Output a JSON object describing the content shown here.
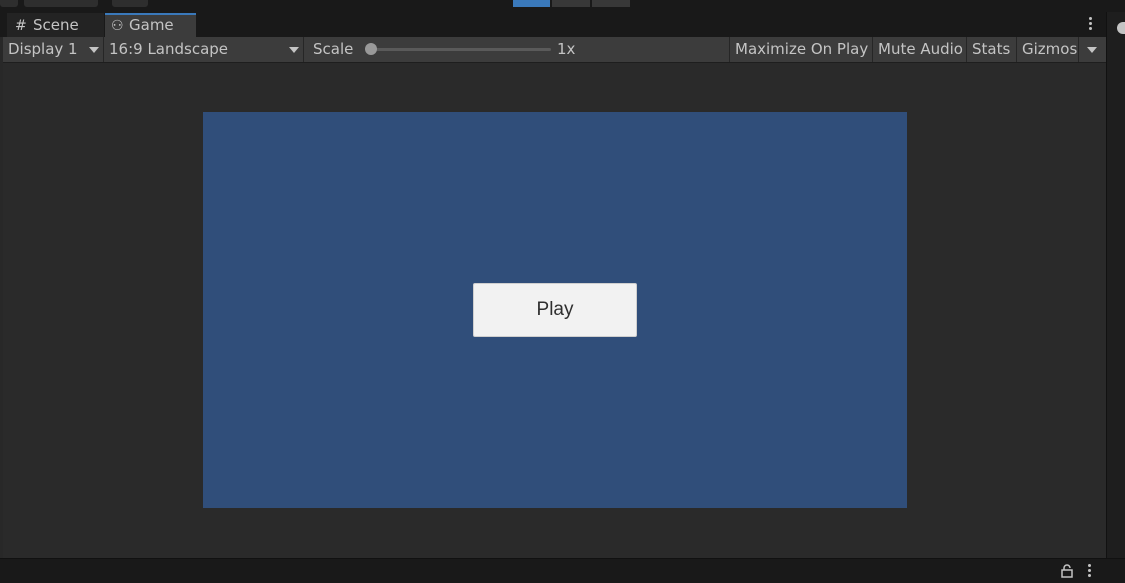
{
  "tabs": [
    {
      "icon": "#",
      "label": "Scene",
      "active": false
    },
    {
      "icon": "⚇",
      "label": "Game",
      "active": true
    }
  ],
  "toolbar": {
    "display": "Display 1",
    "aspect": "16:9 Landscape",
    "scale_label": "Scale",
    "scale_value": "1x",
    "maximize": "Maximize On Play",
    "mute": "Mute Audio",
    "stats": "Stats",
    "gizmos": "Gizmos"
  },
  "game": {
    "background_color": "#304e7a",
    "play_button_label": "Play"
  },
  "colors": {
    "accent": "#3a79bb",
    "panel": "#282828",
    "toolbar": "#3c3c3c"
  }
}
